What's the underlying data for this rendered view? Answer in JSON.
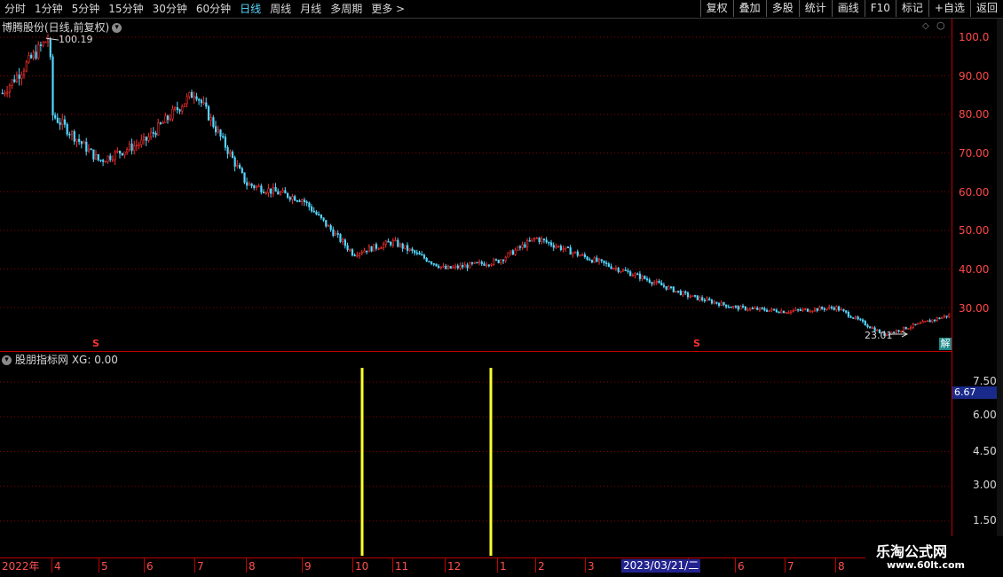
{
  "toolbar": {
    "tabs": [
      "分时",
      "1分钟",
      "5分钟",
      "15分钟",
      "30分钟",
      "60分钟",
      "日线",
      "周线",
      "月线",
      "多周期",
      "更多 >"
    ],
    "active_tab": "日线",
    "buttons": [
      "复权",
      "叠加",
      "多股",
      "统计",
      "画线",
      "F10",
      "标记",
      "+自选",
      "返回"
    ]
  },
  "main_chart": {
    "title": "博腾股份(日线,前复权)",
    "high_label": "100.19",
    "low_label": "23.01",
    "badge": "解",
    "s_marker": "S",
    "y_ticks": [
      "100.0",
      "90.00",
      "80.00",
      "70.00",
      "60.00",
      "50.00",
      "40.00",
      "30.00"
    ]
  },
  "indicator": {
    "title": "股朋指标网 XG: 0.00",
    "y_ticks": [
      "7.50",
      "6.00",
      "4.50",
      "3.00",
      "1.50"
    ],
    "current_value": "6.67"
  },
  "date_axis": {
    "labels": [
      "2022年",
      "4",
      "5",
      "6",
      "7",
      "8",
      "9",
      "10",
      "11",
      "12",
      "1",
      "2",
      "3",
      "5",
      "6",
      "7",
      "8"
    ],
    "cursor_date": "2023/03/21/二"
  },
  "watermark": {
    "line1": "乐淘公式网",
    "line2": "www.60lt.com"
  },
  "colors": {
    "up": "#ff3030",
    "down": "#54d6ff",
    "signal": "#ffff30",
    "grid": "#8a0000",
    "axis": "#c00000"
  },
  "chart_data": {
    "type": "candlestick",
    "title": "博腾股份(日线,前复权)",
    "ylim": [
      22,
      103
    ],
    "y_ticks": [
      30,
      40,
      50,
      60,
      70,
      80,
      90,
      100
    ],
    "close_anchors": [
      {
        "month": "2022-03",
        "close": 85
      },
      {
        "month": "2022-03-end",
        "close": 100.19
      },
      {
        "month": "2022-04",
        "close": 80
      },
      {
        "month": "2022-05",
        "close": 68
      },
      {
        "month": "2022-06",
        "close": 73
      },
      {
        "month": "2022-07",
        "close": 86
      },
      {
        "month": "2022-08",
        "close": 62
      },
      {
        "month": "2022-09",
        "close": 58
      },
      {
        "month": "2022-10",
        "close": 44
      },
      {
        "month": "2022-11",
        "close": 47
      },
      {
        "month": "2022-12",
        "close": 40
      },
      {
        "month": "2023-01",
        "close": 42
      },
      {
        "month": "2023-02",
        "close": 48
      },
      {
        "month": "2023-03",
        "close": 43
      },
      {
        "month": "2023-04",
        "close": 38
      },
      {
        "month": "2023-05",
        "close": 33
      },
      {
        "month": "2023-06",
        "close": 30
      },
      {
        "month": "2023-07",
        "close": 29
      },
      {
        "month": "2023-08",
        "close": 30
      },
      {
        "month": "2023-09",
        "close": 23.01
      },
      {
        "month": "2023-10",
        "close": 28
      }
    ],
    "indicator": {
      "name": "XG",
      "ylim": [
        0,
        8.5
      ],
      "y_ticks": [
        1.5,
        3.0,
        4.5,
        6.0,
        7.5
      ],
      "signal_months": [
        "2022-10",
        "2022-12-end"
      ]
    }
  }
}
